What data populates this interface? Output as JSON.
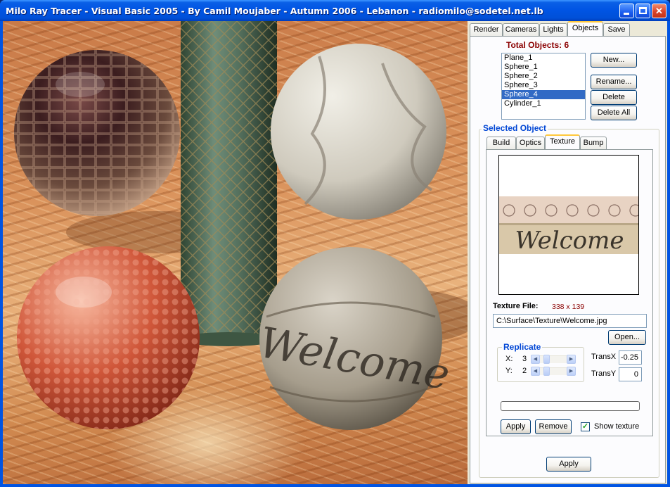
{
  "window": {
    "title": "Milo Ray Tracer - Visual Basic 2005 - By Camil Moujaber - Autumn 2006 - Lebanon - radiomilo@sodetel.net.lb"
  },
  "main_tabs": [
    "Render",
    "Cameras",
    "Lights",
    "Objects",
    "Save"
  ],
  "main_tab_active": "Objects",
  "objects": {
    "total_label": "Total Objects: 6",
    "list": [
      "Plane_1",
      "Sphere_1",
      "Sphere_2",
      "Sphere_3",
      "Sphere_4",
      "Cylinder_1"
    ],
    "selected": "Sphere_4",
    "buttons": {
      "new": "New...",
      "rename": "Rename...",
      "delete": "Delete",
      "delete_all": "Delete All"
    }
  },
  "selected_object": {
    "group_title": "Selected Object",
    "tabs": [
      "Build",
      "Optics",
      "Texture",
      "Bump"
    ],
    "active_tab": "Texture",
    "preview_text": "Welcome",
    "texture_file_label": "Texture File:",
    "texture_size": "338 x 139",
    "texture_path": "C:\\Surface\\Texture\\Welcome.jpg",
    "open_button": "Open...",
    "replicate": {
      "title": "Replicate",
      "x_label": "X:",
      "x_value": "3",
      "y_label": "Y:",
      "y_value": "2"
    },
    "trans_x_label": "TransX",
    "trans_x_value": "-0.25",
    "trans_y_label": "TransY",
    "trans_y_value": "0",
    "progress": 0,
    "apply_button": "Apply",
    "remove_button": "Remove",
    "show_texture_label": "Show texture",
    "show_texture_checked": true
  },
  "footer_apply": "Apply",
  "colors": {
    "title_bar": "#0054e3",
    "selection": "#316ac5",
    "total_objects_text": "#8b0000",
    "group_title": "#0046d5",
    "texture_size_text": "#8b0000"
  }
}
